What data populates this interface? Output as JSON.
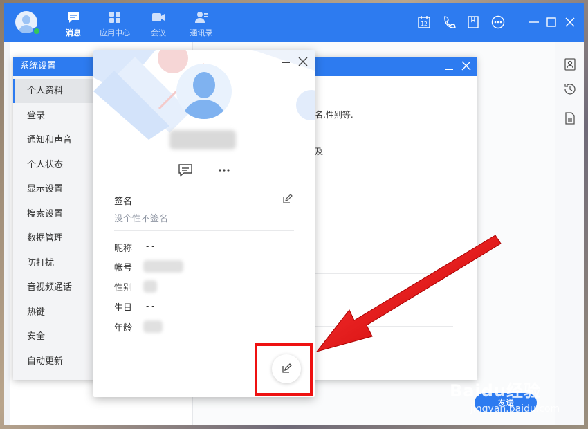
{
  "topbar": {
    "tabs": [
      {
        "label": "消息",
        "icon": "chat-bubble-icon",
        "active": true
      },
      {
        "label": "应用中心",
        "icon": "apps-grid-icon",
        "active": false
      },
      {
        "label": "会议",
        "icon": "video-camera-icon",
        "active": false
      },
      {
        "label": "通讯录",
        "icon": "contacts-icon",
        "active": false
      }
    ],
    "calendar_day": "12",
    "accent_color": "#2d7bf0"
  },
  "right_strip": {
    "icons": [
      "contact-card-icon",
      "history-icon",
      "document-icon"
    ]
  },
  "settings": {
    "title": "系统设置",
    "menu": [
      "个人资料",
      "登录",
      "通知和声音",
      "个人状态",
      "显示设置",
      "搜索设置",
      "数据管理",
      "防打扰",
      "音视频通话",
      "热键",
      "安全",
      "自动更新"
    ],
    "selected": "个人资料",
    "body_text_1": "名,性别等.",
    "body_text_2": "及"
  },
  "card": {
    "name": "username",
    "signature_label": "签名",
    "signature_placeholder": "没个性不签名",
    "fields": [
      {
        "label": "昵称",
        "value": "- -"
      },
      {
        "label": "帐号",
        "value": "account"
      },
      {
        "label": "性别",
        "value": "gender"
      },
      {
        "label": "生日",
        "value": "- -"
      },
      {
        "label": "年龄",
        "value": "age"
      }
    ]
  },
  "chat": {
    "send_label": "发送"
  },
  "watermark": {
    "brand": "Baidu经验",
    "url": "jingyan.baidu.com"
  }
}
